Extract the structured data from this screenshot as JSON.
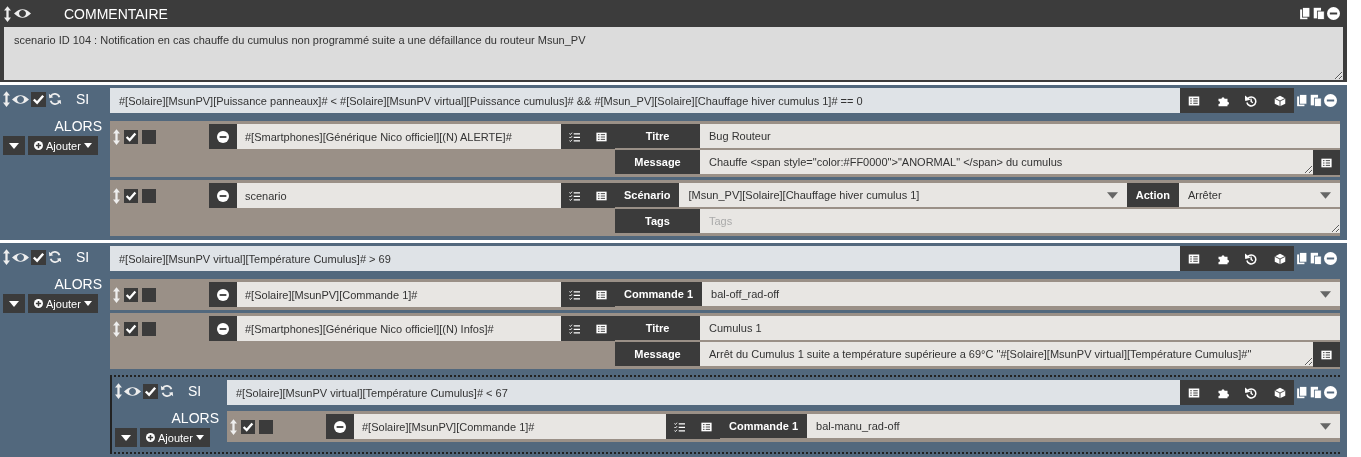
{
  "comment": {
    "title": "COMMENTAIRE",
    "text": "scenario ID 104 : Notification en cas chauffe du cumulus non programmé suite a une défaillance du routeur Msun_PV"
  },
  "blocks": [
    {
      "kind": "si",
      "keyword": "SI",
      "enabled": true,
      "condition": "#[Solaire][MsunPV][Puissance panneaux]# < #[Solaire][MsunPV virtual][Puissance cumulus]# && #[Msun_PV][Solaire][Chauffage hiver cumulus 1]# == 0",
      "then_label": "ALORS",
      "add_label": "Ajouter",
      "items": [
        {
          "kind": "action",
          "enabled": true,
          "parallel": false,
          "expression": "#[Smartphones][Générique Nico officiel][(N) ALERTE]#",
          "rows": [
            [
              {
                "kind": "text",
                "label": "Titre",
                "value": "Bug Routeur"
              }
            ],
            [
              {
                "kind": "textarea",
                "label": "Message",
                "value": "Chauffe <span style=\"color:#FF0000\">\"ANORMAL\" </span> du cumulus",
                "picker": true
              }
            ]
          ]
        },
        {
          "kind": "action",
          "enabled": true,
          "parallel": false,
          "expression": "scenario",
          "rows": [
            [
              {
                "kind": "select",
                "label": "Scénario",
                "value": "[Msun_PV][Solaire][Chauffage hiver cumulus 1]"
              },
              {
                "kind": "select",
                "label": "Action",
                "value": "Arrêter"
              }
            ],
            [
              {
                "kind": "textarea",
                "label": "Tags",
                "placeholder": "Tags",
                "picker": false
              }
            ]
          ]
        }
      ]
    },
    {
      "kind": "si",
      "keyword": "SI",
      "enabled": true,
      "condition": "#[Solaire][MsunPV virtual][Température Cumulus]# > 69",
      "then_label": "ALORS",
      "add_label": "Ajouter",
      "items": [
        {
          "kind": "action",
          "enabled": true,
          "parallel": false,
          "expression": "#[Solaire][MsunPV][Commande 1]#",
          "rows": [
            [
              {
                "kind": "select",
                "label": "Commande 1",
                "value": "bal-off_rad-off"
              }
            ]
          ]
        },
        {
          "kind": "action",
          "enabled": true,
          "parallel": false,
          "expression": "#[Smartphones][Générique Nico officiel][(N) Infos]#",
          "rows": [
            [
              {
                "kind": "text",
                "label": "Titre",
                "value": "Cumulus 1"
              }
            ],
            [
              {
                "kind": "textarea",
                "label": "Message",
                "value": "Arrêt du Cumulus 1 suite a température supérieure a 69°C \"#[Solaire][MsunPV virtual][Température Cumulus]#\"",
                "picker": true
              }
            ]
          ]
        },
        {
          "kind": "si",
          "keyword": "SI",
          "enabled": true,
          "condition": "#[Solaire][MsunPV virtual][Température Cumulus]# < 67",
          "then_label": "ALORS",
          "add_label": "Ajouter",
          "items": [
            {
              "kind": "action",
              "enabled": true,
              "parallel": false,
              "expression": "#[Solaire][MsunPV][Commande 1]#",
              "rows": [
                [
                  {
                    "kind": "select",
                    "label": "Commande 1",
                    "value": "bal-manu_rad-off"
                  }
                ]
              ]
            }
          ]
        }
      ]
    }
  ]
}
